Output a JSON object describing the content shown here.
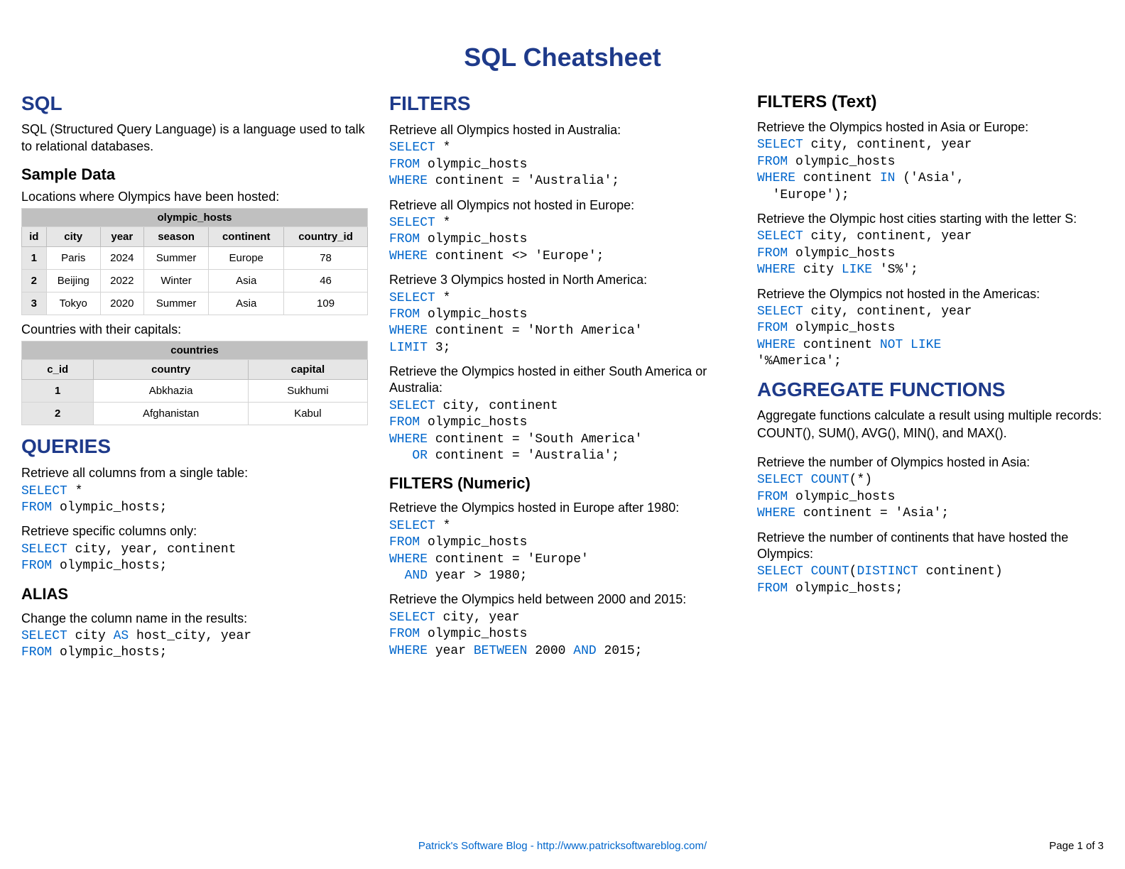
{
  "title": "SQL Cheatsheet",
  "col1": {
    "sql_h": "SQL",
    "sql_intro": "SQL (Structured Query Language) is a language used to talk to relational databases.",
    "sample_h": "Sample Data",
    "sample_cap1": "Locations where Olympics have been hosted:",
    "table1": {
      "name": "olympic_hosts",
      "headers": [
        "id",
        "city",
        "year",
        "season",
        "continent",
        "country_id"
      ],
      "rows": [
        [
          "1",
          "Paris",
          "2024",
          "Summer",
          "Europe",
          "78"
        ],
        [
          "2",
          "Beijing",
          "2022",
          "Winter",
          "Asia",
          "46"
        ],
        [
          "3",
          "Tokyo",
          "2020",
          "Summer",
          "Asia",
          "109"
        ]
      ]
    },
    "sample_cap2": "Countries with their capitals:",
    "table2": {
      "name": "countries",
      "headers": [
        "c_id",
        "country",
        "capital"
      ],
      "rows": [
        [
          "1",
          "Abkhazia",
          "Sukhumi"
        ],
        [
          "2",
          "Afghanistan",
          "Kabul"
        ]
      ]
    },
    "queries_h": "QUERIES",
    "q1_desc": "Retrieve all columns from a single table:",
    "q2_desc": "Retrieve specific columns only:",
    "alias_h": "ALIAS",
    "a1_desc": "Change the column name in the results:"
  },
  "col2": {
    "filters_h": "FILTERS",
    "f1_desc": "Retrieve all Olympics hosted in Australia:",
    "f2_desc": "Retrieve all Olympics not hosted in Europe:",
    "f3_desc": "Retrieve 3 Olympics hosted in North America:",
    "f4_desc": "Retrieve the Olympics hosted in either South America or Australia:",
    "filtnum_h": "FILTERS (Numeric)",
    "n1_desc": "Retrieve the Olympics hosted in Europe after 1980:",
    "n2_desc": "Retrieve the Olympics held between 2000 and 2015:"
  },
  "col3": {
    "filttxt_h": "FILTERS (Text)",
    "t1_desc": "Retrieve the Olympics hosted in Asia or Europe:",
    "t2_desc": "Retrieve the Olympic host cities starting with the letter S:",
    "t3_desc": "Retrieve the Olympics not hosted in the Americas:",
    "agg_h": "AGGREGATE FUNCTIONS",
    "agg_intro": "Aggregate functions calculate a result using multiple records: COUNT(), SUM(), AVG(), MIN(), and MAX().",
    "g1_desc": "Retrieve the number of Olympics hosted in Asia:",
    "g2_desc": "Retrieve the number of continents that have hosted the Olympics:"
  },
  "footer": {
    "center": "Patrick's Software Blog - http://www.patricksoftwareblog.com/",
    "right": "Page 1 of 3"
  }
}
